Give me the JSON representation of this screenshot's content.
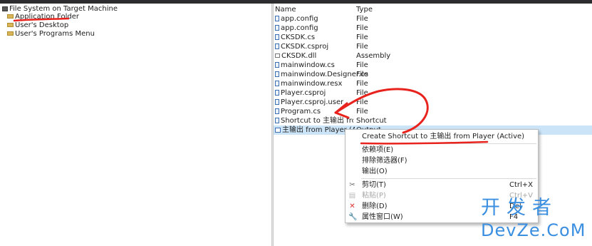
{
  "tree": {
    "root_label": "File System on Target Machine",
    "items": [
      {
        "label": "Application Folder"
      },
      {
        "label": "User's Desktop"
      },
      {
        "label": "User's Programs Menu"
      }
    ]
  },
  "list": {
    "col_name": "Name",
    "col_type": "Type",
    "rows": [
      {
        "name": "app.config",
        "type": "File",
        "icon": "file-icon"
      },
      {
        "name": "app.config",
        "type": "File",
        "icon": "file-icon"
      },
      {
        "name": "CKSDK.cs",
        "type": "File",
        "icon": "file-icon"
      },
      {
        "name": "CKSDK.csproj",
        "type": "File",
        "icon": "file-icon"
      },
      {
        "name": "CKSDK.dll",
        "type": "Assembly",
        "icon": "assembly-icon"
      },
      {
        "name": "mainwindow.cs",
        "type": "File",
        "icon": "file-icon"
      },
      {
        "name": "mainwindow.Designer.cs",
        "type": "File",
        "icon": "file-icon"
      },
      {
        "name": "mainwindow.resx",
        "type": "File",
        "icon": "file-icon"
      },
      {
        "name": "Player.csproj",
        "type": "File",
        "icon": "file-icon"
      },
      {
        "name": "Player.csproj.user",
        "type": "File",
        "icon": "file-icon"
      },
      {
        "name": "Program.cs",
        "type": "File",
        "icon": "file-icon"
      },
      {
        "name": "Shortcut to 主输出 from ...",
        "type": "Shortcut",
        "icon": "shortcut-icon"
      },
      {
        "name": "主输出 from Player (Acti...",
        "type": "Output",
        "icon": "output-icon"
      }
    ]
  },
  "context_menu": {
    "items": [
      {
        "label": "Create Shortcut to 主输出 from Player (Active)",
        "shortcut": "",
        "icon": "",
        "disabled": false
      },
      {
        "label": "依赖项(E)",
        "shortcut": "",
        "icon": "",
        "disabled": false
      },
      {
        "label": "排除筛选器(F)",
        "shortcut": "",
        "icon": "",
        "disabled": false
      },
      {
        "label": "输出(O)",
        "shortcut": "",
        "icon": "",
        "disabled": false
      },
      {
        "label": "剪切(T)",
        "shortcut": "Ctrl+X",
        "icon": "scissors-icon",
        "disabled": false
      },
      {
        "label": "粘贴(P)",
        "shortcut": "Ctrl+V",
        "icon": "paste-icon",
        "disabled": true
      },
      {
        "label": "删除(D)",
        "shortcut": "Del",
        "icon": "delete-icon",
        "disabled": false
      },
      {
        "label": "属性窗口(W)",
        "shortcut": "F4",
        "icon": "wrench-icon",
        "disabled": false
      }
    ]
  },
  "watermark": {
    "line1": "开发者",
    "line2": "DevZe.CoM"
  },
  "colors": {
    "annotation": "#e8221c",
    "selection": "#cce4f7",
    "watermark": "#3b8fe0"
  }
}
